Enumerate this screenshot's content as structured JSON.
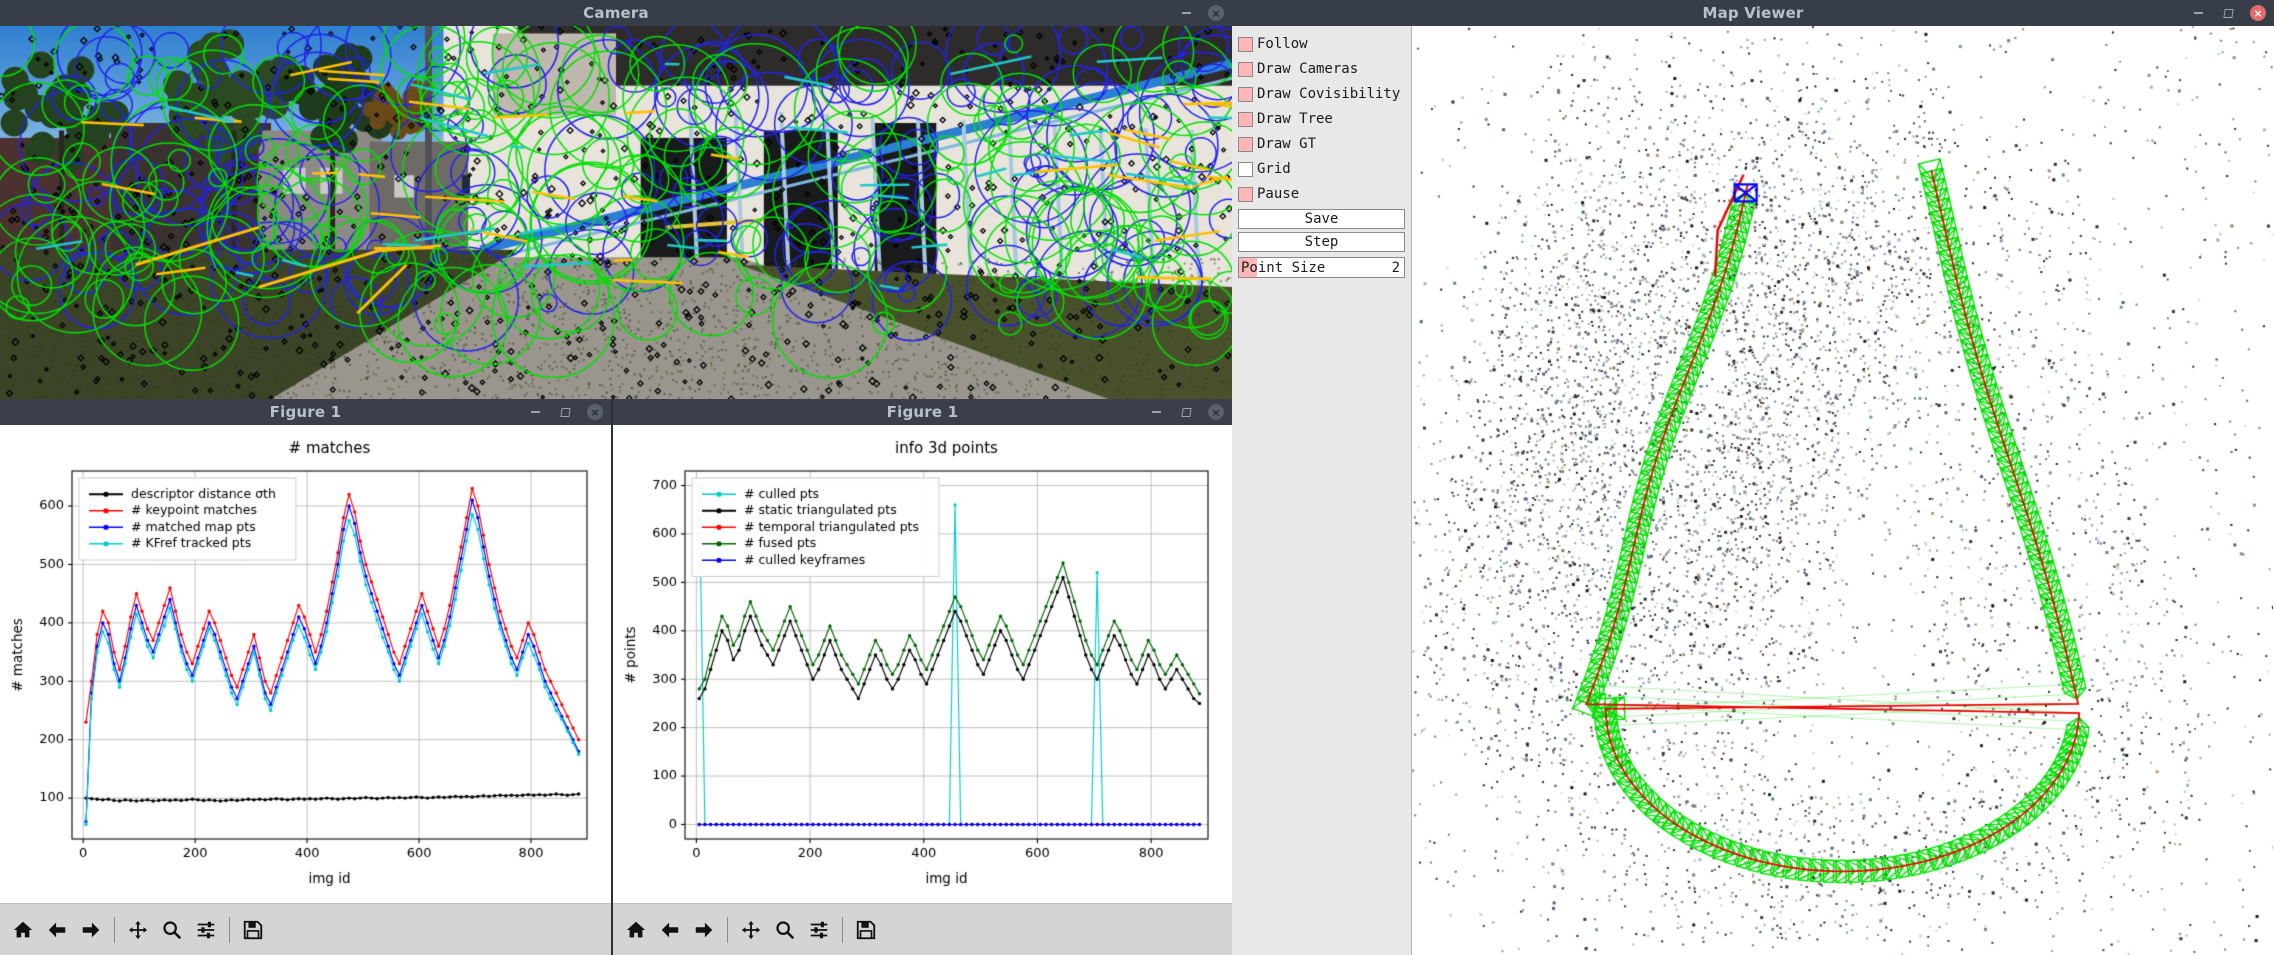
{
  "windows": {
    "camera": {
      "title": "Camera",
      "buttons": {
        "minimize": "minimize",
        "close": "close"
      }
    },
    "figure1": {
      "title": "Figure 1",
      "buttons": {
        "minimize": "minimize",
        "maximize": "maximize",
        "close": "close"
      }
    },
    "figure2": {
      "title": "Figure 1",
      "buttons": {
        "minimize": "minimize",
        "maximize": "maximize",
        "close": "close"
      }
    },
    "map_viewer": {
      "title": "Map Viewer",
      "buttons": {
        "minimize": "minimize",
        "maximize": "maximize",
        "close": "close"
      }
    }
  },
  "map_panel": {
    "checkboxes": [
      {
        "label": "Follow",
        "checked": true
      },
      {
        "label": "Draw Cameras",
        "checked": true
      },
      {
        "label": "Draw Covisibility",
        "checked": true
      },
      {
        "label": "Draw Tree",
        "checked": true
      },
      {
        "label": "Draw GT",
        "checked": true
      },
      {
        "label": "Grid",
        "checked": false
      },
      {
        "label": "Pause",
        "checked": true
      }
    ],
    "buttons": [
      "Save",
      "Step"
    ],
    "slider": {
      "label": "Point Size",
      "value": "2",
      "min": 0,
      "max": 10
    },
    "colors": {
      "checked_fill": "#ffb6b6",
      "panel_bg": "#e8e8e8"
    }
  },
  "map_view": {
    "colors": {
      "keyframe_frustum": "#00e000",
      "trajectory": "#ee0000",
      "current_camera": "#0000ff",
      "background": "#ffffff"
    }
  },
  "camera_view": {
    "overlay_colors": {
      "matched_keypoint": "#00e000",
      "map_point": "#2222ee",
      "flow_track": "#ffc000",
      "unmatched_keypoint": "#000000"
    }
  },
  "mpl_toolbar": {
    "items": [
      {
        "name": "home-icon",
        "tooltip": "Reset original view"
      },
      {
        "name": "back-arrow-icon",
        "tooltip": "Back to previous view"
      },
      {
        "name": "forward-arrow-icon",
        "tooltip": "Forward to next view"
      },
      {
        "name": "pan-icon",
        "tooltip": "Pan axes with left mouse"
      },
      {
        "name": "zoom-icon",
        "tooltip": "Zoom to rectangle"
      },
      {
        "name": "subplots-icon",
        "tooltip": "Configure subplots"
      },
      {
        "name": "save-icon",
        "tooltip": "Save the figure"
      }
    ]
  },
  "chart_data": [
    {
      "type": "line",
      "title": "# matches",
      "xlabel": "img id",
      "ylabel": "# matches",
      "xlim": [
        -20,
        900
      ],
      "ylim": [
        30,
        660
      ],
      "xticks": [
        0,
        200,
        400,
        600,
        800
      ],
      "yticks": [
        100,
        200,
        300,
        400,
        500,
        600
      ],
      "grid": true,
      "legend_position": "upper left",
      "series": [
        {
          "name": "descriptor distance σth",
          "color": "#000000",
          "marker": "o",
          "values": [
            100,
            99,
            98,
            97,
            98,
            96,
            95,
            97,
            96,
            95,
            96,
            97,
            95,
            96,
            97,
            96,
            97,
            96,
            97,
            98,
            97,
            96,
            97,
            96,
            95,
            96,
            97,
            96,
            97,
            98,
            97,
            98,
            97,
            98,
            99,
            98,
            97,
            98,
            99,
            98,
            99,
            98,
            99,
            100,
            99,
            98,
            99,
            100,
            99,
            100,
            101,
            100,
            99,
            100,
            101,
            100,
            101,
            100,
            101,
            102,
            101,
            100,
            101,
            102,
            101,
            102,
            103,
            102,
            103,
            102,
            103,
            104,
            103,
            104,
            105,
            104,
            105,
            104,
            105,
            106,
            105,
            106,
            105,
            106,
            107,
            106,
            105,
            106,
            107
          ]
        },
        {
          "name": "# keypoint matches",
          "color": "#ff0000",
          "marker": "o",
          "values": [
            230,
            300,
            380,
            420,
            400,
            350,
            320,
            360,
            410,
            450,
            420,
            390,
            370,
            400,
            430,
            460,
            420,
            380,
            350,
            330,
            360,
            390,
            420,
            400,
            370,
            340,
            310,
            290,
            320,
            350,
            380,
            340,
            300,
            280,
            310,
            340,
            370,
            400,
            430,
            410,
            380,
            350,
            380,
            420,
            470,
            520,
            580,
            620,
            590,
            540,
            500,
            470,
            440,
            410,
            380,
            350,
            330,
            360,
            390,
            420,
            450,
            420,
            390,
            360,
            390,
            430,
            480,
            530,
            580,
            630,
            600,
            550,
            500,
            460,
            420,
            390,
            360,
            340,
            370,
            400,
            380,
            350,
            320,
            300,
            280,
            260,
            240,
            220,
            200
          ]
        },
        {
          "name": "# matched map pts",
          "color": "#0000ff",
          "marker": "o",
          "values": [
            60,
            280,
            360,
            400,
            380,
            330,
            300,
            340,
            390,
            430,
            400,
            370,
            350,
            380,
            410,
            440,
            400,
            360,
            330,
            310,
            340,
            370,
            400,
            380,
            350,
            320,
            290,
            270,
            300,
            330,
            360,
            320,
            280,
            260,
            290,
            320,
            350,
            380,
            410,
            390,
            360,
            330,
            360,
            400,
            450,
            500,
            560,
            600,
            570,
            520,
            480,
            450,
            420,
            390,
            360,
            330,
            310,
            340,
            370,
            400,
            430,
            400,
            370,
            340,
            370,
            410,
            460,
            510,
            560,
            610,
            580,
            530,
            480,
            440,
            400,
            370,
            340,
            320,
            350,
            380,
            360,
            330,
            300,
            280,
            260,
            240,
            220,
            200,
            180
          ]
        },
        {
          "name": "# KFref tracked pts",
          "color": "#00cccc",
          "marker": "o",
          "values": [
            55,
            270,
            350,
            385,
            365,
            320,
            290,
            330,
            375,
            415,
            390,
            360,
            340,
            370,
            395,
            425,
            390,
            350,
            320,
            300,
            330,
            360,
            390,
            370,
            340,
            310,
            280,
            260,
            290,
            320,
            350,
            310,
            270,
            250,
            280,
            310,
            340,
            370,
            395,
            375,
            345,
            320,
            350,
            385,
            435,
            480,
            540,
            575,
            550,
            505,
            465,
            435,
            405,
            375,
            350,
            320,
            300,
            330,
            360,
            390,
            415,
            385,
            355,
            330,
            360,
            395,
            440,
            490,
            540,
            585,
            560,
            510,
            465,
            425,
            390,
            360,
            330,
            310,
            340,
            365,
            345,
            320,
            290,
            270,
            250,
            235,
            215,
            195,
            175
          ]
        }
      ]
    },
    {
      "type": "line",
      "title": "info 3d points",
      "xlabel": "img id",
      "ylabel": "# points",
      "xlim": [
        -20,
        900
      ],
      "ylim": [
        -30,
        730
      ],
      "xticks": [
        0,
        200,
        400,
        600,
        800
      ],
      "yticks": [
        0,
        100,
        200,
        300,
        400,
        500,
        600,
        700
      ],
      "grid": true,
      "legend_position": "upper left",
      "series": [
        {
          "name": "# culled pts",
          "color": "#00cccc",
          "marker": "o",
          "values": [
            700,
            0,
            0,
            0,
            0,
            0,
            0,
            0,
            0,
            0,
            0,
            0,
            0,
            0,
            0,
            0,
            0,
            0,
            0,
            0,
            0,
            0,
            0,
            0,
            0,
            0,
            0,
            0,
            0,
            0,
            0,
            0,
            0,
            0,
            0,
            0,
            0,
            0,
            0,
            0,
            0,
            0,
            0,
            0,
            0,
            660,
            0,
            0,
            0,
            0,
            0,
            0,
            0,
            0,
            0,
            0,
            0,
            0,
            0,
            0,
            0,
            0,
            0,
            0,
            0,
            0,
            0,
            0,
            0,
            0,
            520,
            0,
            0,
            0,
            0,
            0,
            0,
            0,
            0,
            0,
            0,
            0,
            0,
            0,
            0,
            0,
            0,
            0,
            0
          ]
        },
        {
          "name": "# static triangulated pts",
          "color": "#000000",
          "marker": "o",
          "values": [
            260,
            280,
            320,
            360,
            400,
            380,
            340,
            360,
            400,
            430,
            400,
            370,
            350,
            330,
            360,
            390,
            420,
            390,
            360,
            330,
            300,
            320,
            350,
            380,
            350,
            320,
            300,
            280,
            260,
            290,
            320,
            350,
            330,
            300,
            280,
            300,
            330,
            360,
            340,
            310,
            290,
            320,
            350,
            380,
            410,
            440,
            420,
            390,
            360,
            330,
            310,
            340,
            370,
            400,
            380,
            350,
            320,
            300,
            330,
            360,
            390,
            420,
            450,
            480,
            510,
            470,
            430,
            390,
            350,
            320,
            300,
            330,
            360,
            390,
            370,
            340,
            310,
            290,
            320,
            350,
            330,
            300,
            280,
            300,
            320,
            300,
            280,
            260,
            250
          ]
        },
        {
          "name": "# temporal triangulated pts",
          "color": "#ff0000",
          "marker": "o",
          "values": [
            0,
            0,
            0,
            0,
            0,
            0,
            0,
            0,
            0,
            0,
            0,
            0,
            0,
            0,
            0,
            0,
            0,
            0,
            0,
            0,
            0,
            0,
            0,
            0,
            0,
            0,
            0,
            0,
            0,
            0,
            0,
            0,
            0,
            0,
            0,
            0,
            0,
            0,
            0,
            0,
            0,
            0,
            0,
            0,
            0,
            0,
            0,
            0,
            0,
            0,
            0,
            0,
            0,
            0,
            0,
            0,
            0,
            0,
            0,
            0,
            0,
            0,
            0,
            0,
            0,
            0,
            0,
            0,
            0,
            0,
            0,
            0,
            0,
            0,
            0,
            0,
            0,
            0,
            0,
            0,
            0,
            0,
            0,
            0,
            0,
            0,
            0,
            0,
            0
          ]
        },
        {
          "name": "# fused pts",
          "color": "#006600",
          "marker": "o",
          "values": [
            280,
            300,
            350,
            390,
            430,
            410,
            370,
            390,
            430,
            460,
            430,
            400,
            380,
            360,
            390,
            420,
            450,
            420,
            390,
            360,
            330,
            350,
            380,
            410,
            380,
            350,
            330,
            310,
            290,
            320,
            350,
            380,
            360,
            330,
            310,
            330,
            360,
            390,
            370,
            340,
            320,
            350,
            380,
            410,
            440,
            470,
            450,
            420,
            390,
            360,
            340,
            370,
            400,
            430,
            410,
            380,
            350,
            330,
            360,
            390,
            420,
            450,
            480,
            510,
            540,
            500,
            460,
            420,
            380,
            350,
            330,
            360,
            390,
            420,
            400,
            370,
            340,
            320,
            350,
            380,
            360,
            330,
            310,
            330,
            350,
            330,
            310,
            290,
            270
          ]
        },
        {
          "name": "# culled keyframes",
          "color": "#0000ff",
          "marker": "o",
          "values": [
            0,
            0,
            0,
            0,
            0,
            0,
            0,
            0,
            0,
            0,
            0,
            0,
            0,
            0,
            0,
            0,
            0,
            0,
            0,
            0,
            0,
            0,
            0,
            0,
            0,
            0,
            0,
            0,
            0,
            0,
            0,
            0,
            0,
            0,
            0,
            0,
            0,
            0,
            0,
            0,
            0,
            0,
            0,
            0,
            0,
            0,
            0,
            0,
            0,
            0,
            0,
            0,
            0,
            0,
            0,
            0,
            0,
            0,
            0,
            0,
            0,
            0,
            0,
            0,
            0,
            0,
            0,
            0,
            0,
            0,
            0,
            0,
            0,
            0,
            0,
            0,
            0,
            0,
            0,
            0,
            0,
            0,
            0,
            0,
            0,
            0,
            0,
            0,
            0
          ]
        }
      ]
    }
  ]
}
